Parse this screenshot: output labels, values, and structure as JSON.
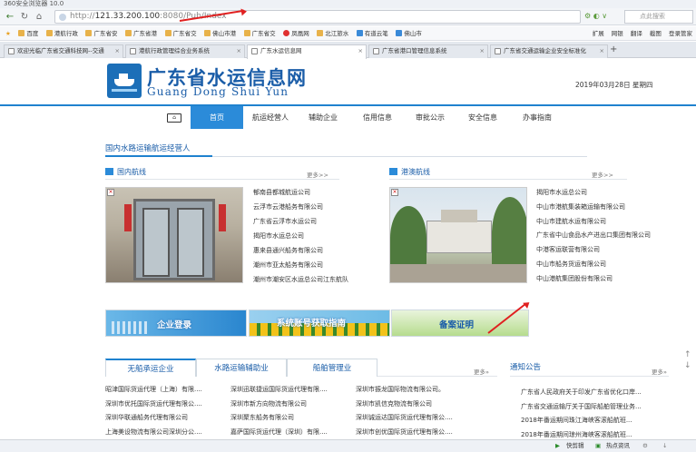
{
  "browser": {
    "title": "360安全浏览器 10.0",
    "url_prefix": "http://",
    "url_host": "121.33.200.100",
    "url_path": ":8080/Pub/Index",
    "search_placeholder": "点此搜索",
    "bookmarks": [
      "百度",
      "港航行政",
      "广东省安",
      "广东省港",
      "广东省交",
      "佛山市港",
      "广东省交",
      "凤凰网",
      "北江旅水",
      "有道云笔",
      "佛山市"
    ],
    "bookmarks_right": [
      "扩展",
      "网银",
      "翻译",
      "截图",
      "登录管家"
    ],
    "tabs": [
      "欢迎光临广东省交通科技网--交通",
      "港航行政管理综合业务系统",
      "广东水运信息网",
      "广东省港口管理信息系统",
      "广东省交通运输企业安全标准化"
    ],
    "status_items": [
      "快剪辑",
      "热点资讯"
    ]
  },
  "site": {
    "title_cn": "广东省水运信息网",
    "title_en": "Guang Dong Shui Yun",
    "date": "2019年03月28日 星期四",
    "nav": [
      "首页",
      "航运经营人",
      "辅助企业",
      "信用信息",
      "审批公示",
      "安全信息",
      "办事指南"
    ],
    "section_title": "国内水路运输航运经营人",
    "domestic": {
      "title": "国内航线",
      "more": "更多>>",
      "items": [
        "郁南县都城航运公司",
        "云浮市云港船务有限公司",
        "广东省云浮市水运公司",
        "揭阳市水运总公司",
        "惠来县通兴船务有限公司",
        "潮州市亚太船务有限公司",
        "潮州市潮安区水运总公司江东航队"
      ]
    },
    "hkmacau": {
      "title": "港澳航线",
      "more": "更多>>",
      "items": [
        "揭阳市水运总公司",
        "中山市港航集装箱运输有限公司",
        "中山市建航水运有限公司",
        "广东省中山食品水产进出口集团有限公司",
        "中港客运联营有限公司",
        "中山市船务货运有限公司",
        "中山港航集团股份有限公司"
      ]
    },
    "banners": [
      "企业登录",
      "系统账号获取指南",
      "备案证明"
    ],
    "bottom_tabs": [
      "无船承运企业",
      "水路运输辅助业",
      "船舶管理业"
    ],
    "bottom_more": "更多»",
    "col1": [
      "昭津国际货运代理（上海）有限....",
      "深圳市优托国际货运代理有限公....",
      "深圳华联通船务代理有限公司",
      "上海美设物流有限公司深圳分公...."
    ],
    "col2": [
      "深圳迅联捷运国际货运代理有限....",
      "深圳市新方向物流有限公司",
      "深圳聚东船务有限公司",
      "嘉萨国际货运代理（深圳）有限...."
    ],
    "col3": [
      "深圳市振龙国际物流有限公司。",
      "深圳市凯信克物流有限公司",
      "深圳诚运达国际货运代理有限公....",
      "深圳市创优国际货运代理有限公...."
    ],
    "notice_title": "通知公告",
    "notice_more": "更多»",
    "notices": [
      "广东省人民政府关于印发广东省优化口岸...",
      "广东省交通运输厅关于国际船舶管理业务...",
      "2018年番运期间珠江海峡客滚船航班...",
      "2018年番运期间琼州海峡客滚船航班..."
    ]
  }
}
